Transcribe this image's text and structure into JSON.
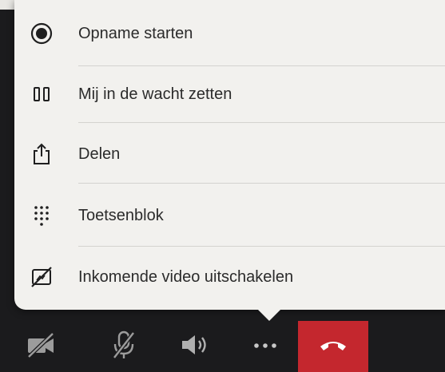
{
  "menu": {
    "items": [
      {
        "label": "Opname starten",
        "icon": "record-icon"
      },
      {
        "label": "Mij in de wacht zetten",
        "icon": "pause-icon"
      },
      {
        "label": "Delen",
        "icon": "share-icon"
      },
      {
        "label": "Toetsenblok",
        "icon": "dialpad-icon"
      },
      {
        "label": "Inkomende video uitschakelen",
        "icon": "video-off-icon"
      }
    ]
  },
  "toolbar": {
    "buttons": [
      {
        "icon": "camera-off-icon"
      },
      {
        "icon": "microphone-off-icon"
      },
      {
        "icon": "speaker-icon"
      },
      {
        "icon": "more-options-icon"
      },
      {
        "icon": "end-call-icon"
      }
    ]
  },
  "colors": {
    "menu_background": "#f2f1ee",
    "toolbar_background": "#1b1b1d",
    "end_call": "#c4272e",
    "text": "#2b2b2b"
  }
}
